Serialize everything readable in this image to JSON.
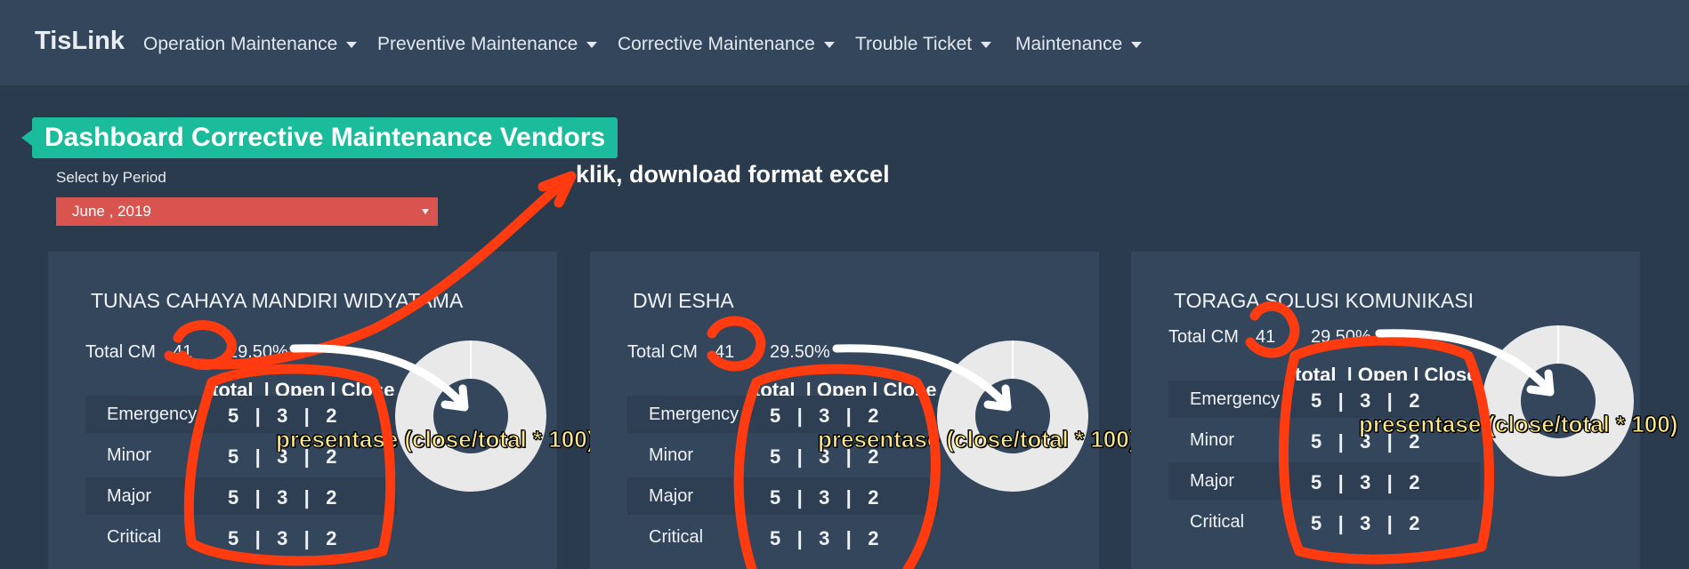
{
  "nav": {
    "brand": "TisLink",
    "items": [
      {
        "label": "Operation Maintenance"
      },
      {
        "label": "Preventive Maintenance"
      },
      {
        "label": "Corrective Maintenance"
      },
      {
        "label": "Trouble Ticket"
      },
      {
        "label": "Maintenance"
      }
    ]
  },
  "page": {
    "title": "Dashboard Corrective Maintenance Vendors",
    "period_label": "Select by Period",
    "period_value": "June , 2019"
  },
  "annotations": {
    "download": "klik, download format excel",
    "formula": "presentase (close/total * 100)",
    "annotation_color": "#ff3b0f"
  },
  "table_header": "total  | Open | Close",
  "vendors": [
    {
      "name": "TUNAS CAHAYA MANDIRI WIDYATAMA",
      "total_label": "Total CM",
      "total": "41",
      "percent": "29.50%",
      "rows": [
        {
          "category": "Emergency",
          "total": "5",
          "open": "3",
          "close": "2"
        },
        {
          "category": "Minor",
          "total": "5",
          "open": "3",
          "close": "2"
        },
        {
          "category": "Major",
          "total": "5",
          "open": "3",
          "close": "2"
        },
        {
          "category": "Critical",
          "total": "5",
          "open": "3",
          "close": "2"
        }
      ]
    },
    {
      "name": "DWI ESHA",
      "total_label": "Total CM",
      "total": "41",
      "percent": "29.50%",
      "rows": [
        {
          "category": "Emergency",
          "total": "5",
          "open": "3",
          "close": "2"
        },
        {
          "category": "Minor",
          "total": "5",
          "open": "3",
          "close": "2"
        },
        {
          "category": "Major",
          "total": "5",
          "open": "3",
          "close": "2"
        },
        {
          "category": "Critical",
          "total": "5",
          "open": "3",
          "close": "2"
        }
      ]
    },
    {
      "name": "TORAGA SOLUSI KOMUNIKASI",
      "total_label": "Total CM",
      "total": "41",
      "percent": "29.50%",
      "rows": [
        {
          "category": "Emergency",
          "total": "5",
          "open": "3",
          "close": "2"
        },
        {
          "category": "Minor",
          "total": "5",
          "open": "3",
          "close": "2"
        },
        {
          "category": "Major",
          "total": "5",
          "open": "3",
          "close": "2"
        },
        {
          "category": "Critical",
          "total": "5",
          "open": "3",
          "close": "2"
        }
      ]
    }
  ]
}
